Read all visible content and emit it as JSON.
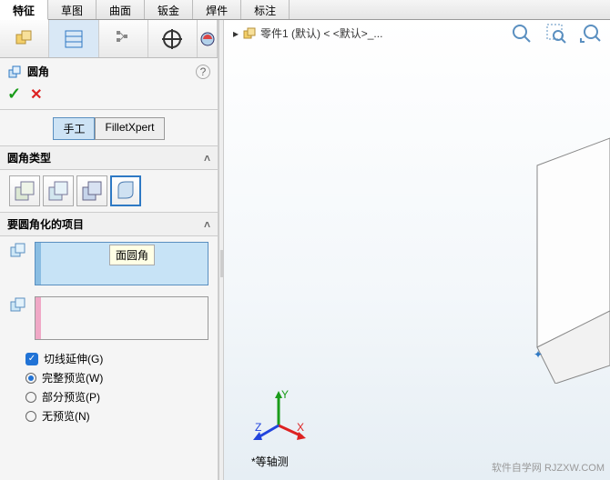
{
  "tabs": [
    "特征",
    "草图",
    "曲面",
    "钣金",
    "焊件",
    "标注"
  ],
  "feature": {
    "title": "圆角"
  },
  "mode": {
    "manual": "手工",
    "xpert": "FilletXpert"
  },
  "sections": {
    "type": "圆角类型",
    "items": "要圆角化的项目"
  },
  "tooltip": "面圆角",
  "options": {
    "tangent": "切线延伸(G)",
    "full": "完整预览(W)",
    "partial": "部分预览(P)",
    "none": "无预览(N)"
  },
  "breadcrumb": "零件1 (默认) < <默认>_...",
  "viewlabel": "*等轴测",
  "watermark": "软件自学网 RJZXW.COM"
}
